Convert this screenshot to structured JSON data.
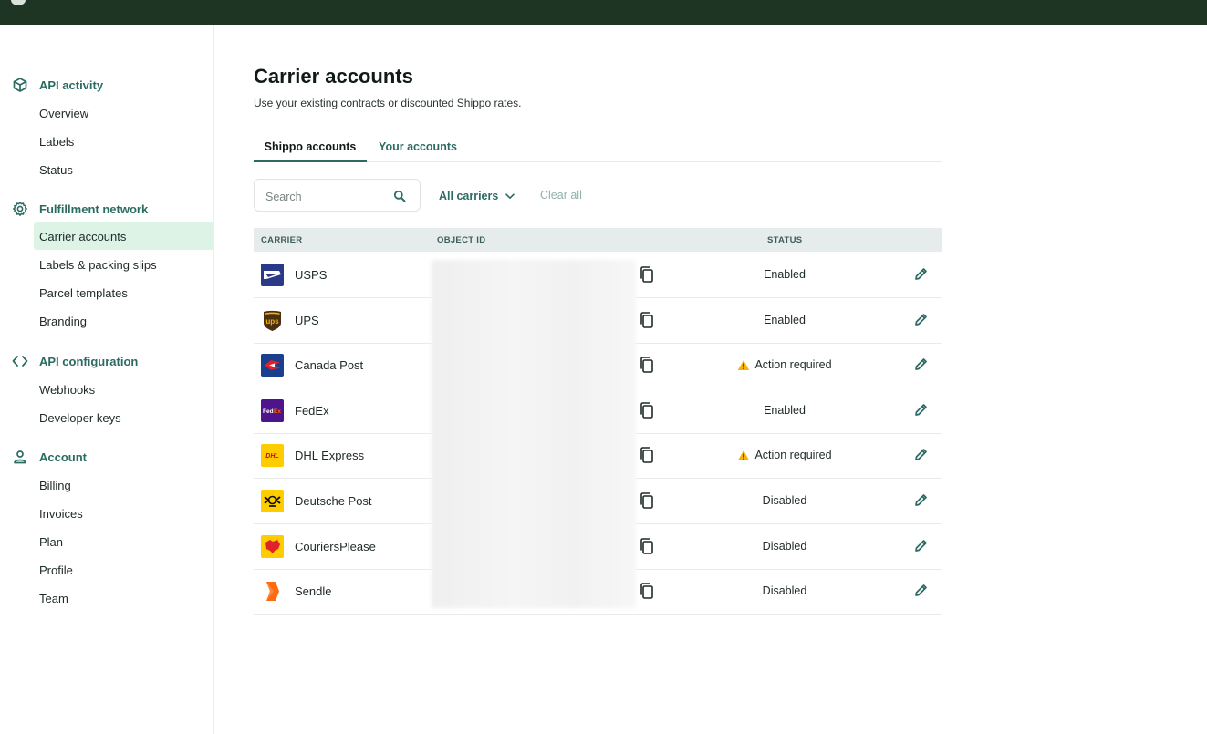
{
  "sidebar": {
    "sections": [
      {
        "title": "API activity",
        "icon": "cube-icon",
        "items": [
          "Overview",
          "Labels",
          "Status"
        ]
      },
      {
        "title": "Fulfillment network",
        "icon": "gear-icon",
        "items": [
          "Carrier accounts",
          "Labels & packing slips",
          "Parcel templates",
          "Branding"
        ]
      },
      {
        "title": "API configuration",
        "icon": "code-icon",
        "items": [
          "Webhooks",
          "Developer keys"
        ]
      },
      {
        "title": "Account",
        "icon": "person-icon",
        "items": [
          "Billing",
          "Invoices",
          "Plan",
          "Profile",
          "Team"
        ]
      }
    ],
    "active_item": "Carrier accounts"
  },
  "page": {
    "title": "Carrier accounts",
    "subtitle": "Use your existing contracts or discounted Shippo rates.",
    "tabs": [
      "Shippo accounts",
      "Your accounts"
    ],
    "active_tab": "Shippo accounts"
  },
  "filters": {
    "search_placeholder": "Search",
    "carriers_label": "All carriers",
    "clear_label": "Clear all"
  },
  "table": {
    "columns": {
      "carrier": "CARRIER",
      "object_id": "OBJECT ID",
      "status": "STATUS"
    },
    "rows": [
      {
        "carrier": "USPS",
        "status": "Enabled",
        "warning": false,
        "logo": "usps-logo"
      },
      {
        "carrier": "UPS",
        "status": "Enabled",
        "warning": false,
        "logo": "ups-logo"
      },
      {
        "carrier": "Canada Post",
        "status": "Action required",
        "warning": true,
        "logo": "canada-post-logo"
      },
      {
        "carrier": "FedEx",
        "status": "Enabled",
        "warning": false,
        "logo": "fedex-logo"
      },
      {
        "carrier": "DHL Express",
        "status": "Action required",
        "warning": true,
        "logo": "dhl-logo"
      },
      {
        "carrier": "Deutsche Post",
        "status": "Disabled",
        "warning": false,
        "logo": "deutsche-post-logo"
      },
      {
        "carrier": "CouriersPlease",
        "status": "Disabled",
        "warning": false,
        "logo": "couriersplease-logo"
      },
      {
        "carrier": "Sendle",
        "status": "Disabled",
        "warning": false,
        "logo": "sendle-logo"
      }
    ]
  },
  "colors": {
    "accent": "#2c6b64",
    "active_bg": "#dcf3e6",
    "topbar": "#1f3523",
    "warning": "#f5b400"
  }
}
